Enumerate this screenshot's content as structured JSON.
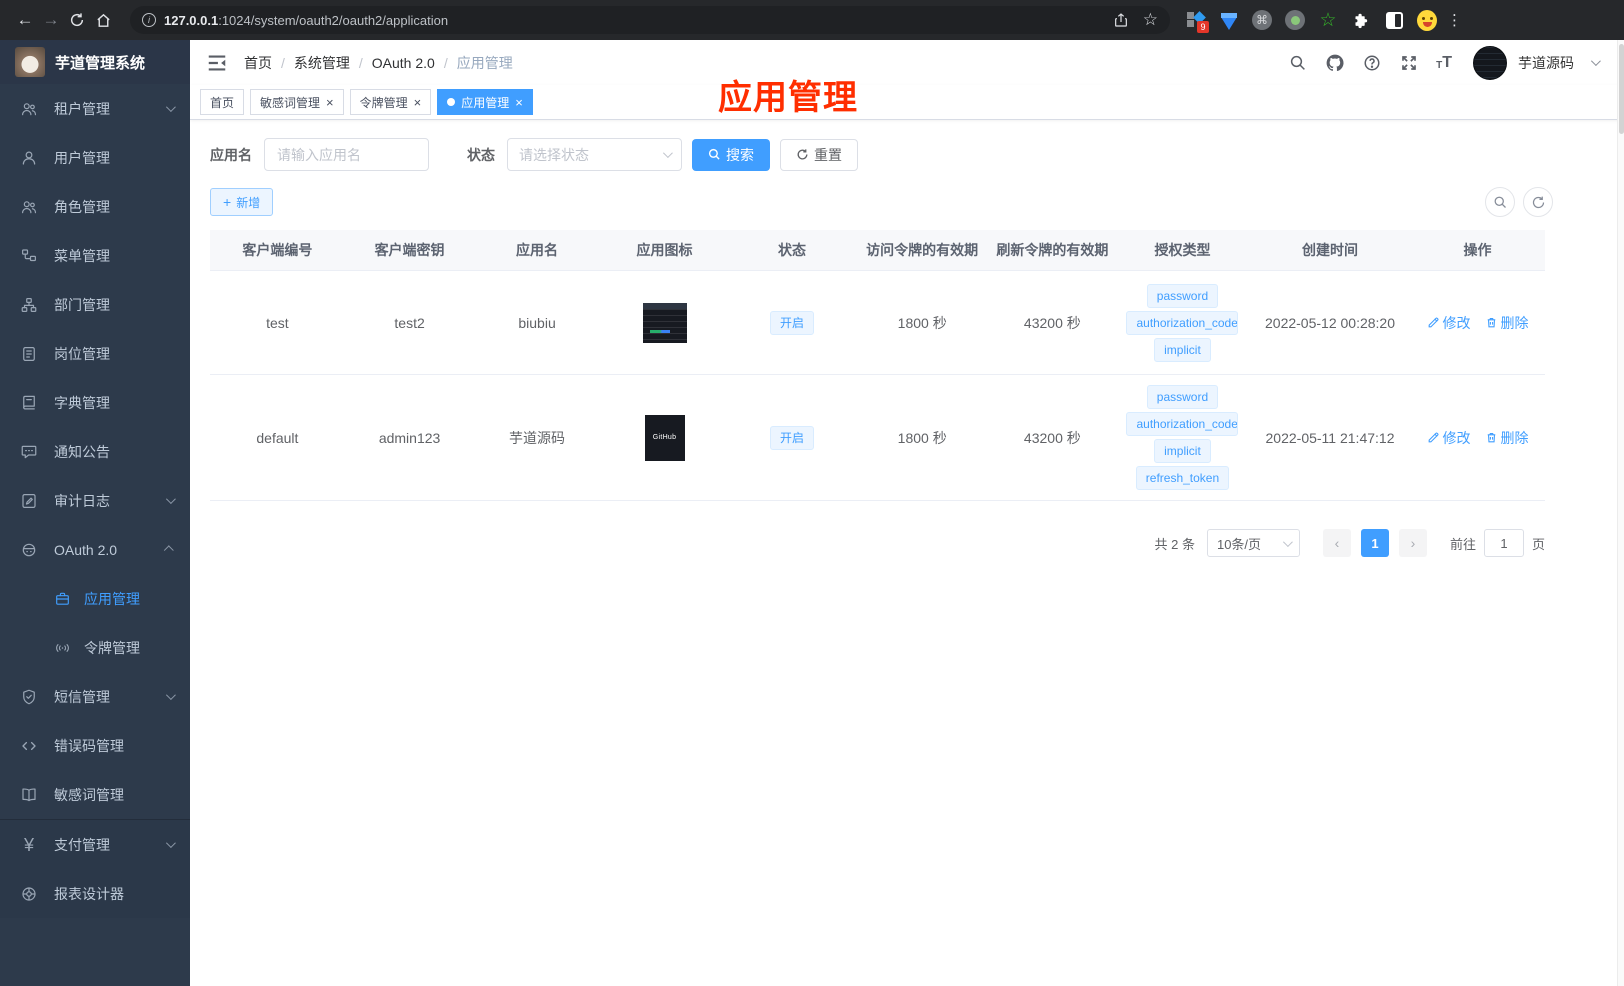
{
  "browser": {
    "url_host": "127.0.0.1",
    "url_rest": ":1024/system/oauth2/oauth2/application",
    "extension_badge": "9"
  },
  "sidebar": {
    "logo_title": "芋道管理系统",
    "items": [
      {
        "label": "租户管理",
        "icon": "users-icon",
        "chevron": "down"
      },
      {
        "label": "用户管理",
        "icon": "user-icon"
      },
      {
        "label": "角色管理",
        "icon": "users-icon"
      },
      {
        "label": "菜单管理",
        "icon": "tree-icon"
      },
      {
        "label": "部门管理",
        "icon": "org-icon"
      },
      {
        "label": "岗位管理",
        "icon": "badge-icon"
      },
      {
        "label": "字典管理",
        "icon": "dict-icon"
      },
      {
        "label": "通知公告",
        "icon": "message-icon"
      },
      {
        "label": "审计日志",
        "icon": "log-icon",
        "chevron": "down"
      },
      {
        "label": "OAuth 2.0",
        "icon": "robot-icon",
        "chevron": "up"
      },
      {
        "label": "应用管理",
        "icon": "briefcase-icon",
        "child": true,
        "active": true
      },
      {
        "label": "令牌管理",
        "icon": "token-icon",
        "child": true
      },
      {
        "label": "短信管理",
        "icon": "shield-icon",
        "chevron": "down"
      },
      {
        "label": "错误码管理",
        "icon": "code-icon"
      },
      {
        "label": "敏感词管理",
        "icon": "book-icon"
      },
      {
        "label": "支付管理",
        "icon": "yen-icon",
        "chevron": "down",
        "section": "bottom"
      },
      {
        "label": "报表设计器",
        "icon": "wheel-icon",
        "section": "bottom"
      }
    ]
  },
  "header": {
    "breadcrumbs": [
      "首页",
      "系统管理",
      "OAuth 2.0",
      "应用管理"
    ],
    "username": "芋道源码"
  },
  "tabs": [
    {
      "label": "首页"
    },
    {
      "label": "敏感词管理",
      "closable": true
    },
    {
      "label": "令牌管理",
      "closable": true
    },
    {
      "label": "应用管理",
      "closable": true,
      "active": true
    }
  ],
  "annotation": {
    "text": "应用管理"
  },
  "filter": {
    "name_label": "应用名",
    "name_placeholder": "请输入应用名",
    "status_label": "状态",
    "status_placeholder": "请选择状态",
    "search_label": "搜索",
    "reset_label": "重置",
    "add_label": "新增"
  },
  "table": {
    "headers": [
      "客户端编号",
      "客户端密钥",
      "应用名",
      "应用图标",
      "状态",
      "访问令牌的有效期",
      "刷新令牌的有效期",
      "授权类型",
      "创建时间",
      "操作"
    ],
    "rows": [
      {
        "client_id": "test",
        "client_secret": "test2",
        "app_name": "biubiu",
        "icon_style": "dashboard",
        "icon_text": "",
        "status": "开启",
        "access_validity": "1800 秒",
        "refresh_validity": "43200 秒",
        "grant_types": [
          "password",
          "authorization_code",
          "implicit"
        ],
        "created_at": "2022-05-12 00:28:20"
      },
      {
        "client_id": "default",
        "client_secret": "admin123",
        "app_name": "芋道源码",
        "icon_style": "github",
        "icon_text": "GitHub",
        "status": "开启",
        "access_validity": "1800 秒",
        "refresh_validity": "43200 秒",
        "grant_types": [
          "password",
          "authorization_code",
          "implicit",
          "refresh_token"
        ],
        "created_at": "2022-05-11 21:47:12"
      }
    ],
    "edit_label": "修改",
    "delete_label": "删除"
  },
  "pagination": {
    "total_text": "共 2 条",
    "page_size_text": "10条/页",
    "current_page": "1",
    "goto_label": "前往",
    "goto_value": "1",
    "page_unit": "页"
  },
  "colors": {
    "primary": "#409eff",
    "annotation_red": "#ff2e00",
    "sidebar_bg": "#2d3a4b",
    "tag_bg": "#ecf5ff"
  }
}
